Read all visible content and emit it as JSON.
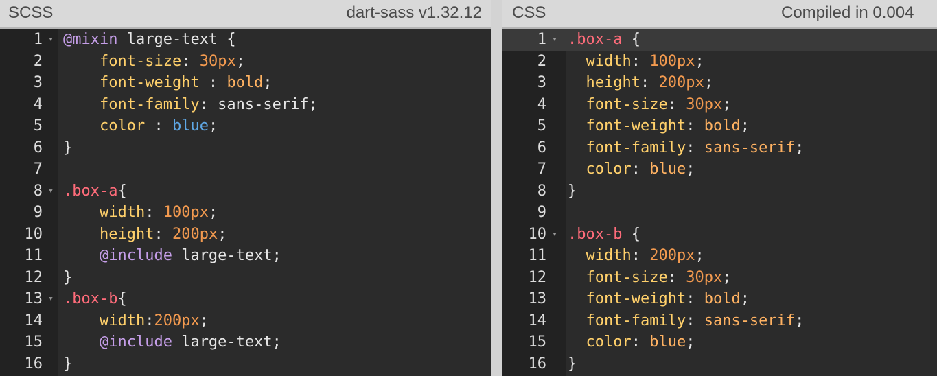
{
  "colors": {
    "background": "#2b2b2b",
    "gutter": "#222222",
    "header": "#d9d9d9",
    "property": "#ffd06b",
    "number": "#f39a4f",
    "selector": "#ff6c7a",
    "at_rule": "#c59ee8",
    "keyword": "#ffb262",
    "color_value": "#5fa8e6"
  },
  "left_pane": {
    "title": "SCSS",
    "info": "dart-sass v1.32.12",
    "lines": [
      {
        "n": "1",
        "fold": true,
        "tokens": [
          {
            "t": "@mixin",
            "c": "at"
          },
          {
            "t": " large-text {",
            "c": "plain"
          }
        ]
      },
      {
        "n": "2",
        "fold": false,
        "tokens": [
          {
            "t": "    ",
            "c": "plain"
          },
          {
            "t": "font-size",
            "c": "prop"
          },
          {
            "t": ": ",
            "c": "plain"
          },
          {
            "t": "30px",
            "c": "num"
          },
          {
            "t": ";",
            "c": "plain"
          }
        ]
      },
      {
        "n": "3",
        "fold": false,
        "tokens": [
          {
            "t": "    ",
            "c": "plain"
          },
          {
            "t": "font-weight",
            "c": "prop"
          },
          {
            "t": " : ",
            "c": "plain"
          },
          {
            "t": "bold",
            "c": "kw"
          },
          {
            "t": ";",
            "c": "plain"
          }
        ]
      },
      {
        "n": "4",
        "fold": false,
        "tokens": [
          {
            "t": "    ",
            "c": "plain"
          },
          {
            "t": "font-family",
            "c": "prop"
          },
          {
            "t": ": sans-serif;",
            "c": "plain"
          }
        ]
      },
      {
        "n": "5",
        "fold": false,
        "tokens": [
          {
            "t": "    ",
            "c": "plain"
          },
          {
            "t": "color",
            "c": "prop"
          },
          {
            "t": " : ",
            "c": "plain"
          },
          {
            "t": "blue",
            "c": "blue"
          },
          {
            "t": ";",
            "c": "plain"
          }
        ]
      },
      {
        "n": "6",
        "fold": false,
        "tokens": [
          {
            "t": "}",
            "c": "plain"
          }
        ]
      },
      {
        "n": "7",
        "fold": false,
        "tokens": []
      },
      {
        "n": "8",
        "fold": true,
        "tokens": [
          {
            "t": ".box-a",
            "c": "sel"
          },
          {
            "t": "{",
            "c": "plain"
          }
        ]
      },
      {
        "n": "9",
        "fold": false,
        "tokens": [
          {
            "t": "    ",
            "c": "plain"
          },
          {
            "t": "width",
            "c": "prop"
          },
          {
            "t": ": ",
            "c": "plain"
          },
          {
            "t": "100px",
            "c": "num"
          },
          {
            "t": ";",
            "c": "plain"
          }
        ]
      },
      {
        "n": "10",
        "fold": false,
        "tokens": [
          {
            "t": "    ",
            "c": "plain"
          },
          {
            "t": "height",
            "c": "prop"
          },
          {
            "t": ": ",
            "c": "plain"
          },
          {
            "t": "200px",
            "c": "num"
          },
          {
            "t": ";",
            "c": "plain"
          }
        ]
      },
      {
        "n": "11",
        "fold": false,
        "tokens": [
          {
            "t": "    ",
            "c": "plain"
          },
          {
            "t": "@include",
            "c": "at"
          },
          {
            "t": " large-text;",
            "c": "plain"
          }
        ]
      },
      {
        "n": "12",
        "fold": false,
        "tokens": [
          {
            "t": "}",
            "c": "plain"
          }
        ]
      },
      {
        "n": "13",
        "fold": true,
        "tokens": [
          {
            "t": ".box-b",
            "c": "sel"
          },
          {
            "t": "{",
            "c": "plain"
          }
        ]
      },
      {
        "n": "14",
        "fold": false,
        "tokens": [
          {
            "t": "    ",
            "c": "plain"
          },
          {
            "t": "width",
            "c": "prop"
          },
          {
            "t": ":",
            "c": "plain"
          },
          {
            "t": "200px",
            "c": "num"
          },
          {
            "t": ";",
            "c": "plain"
          }
        ]
      },
      {
        "n": "15",
        "fold": false,
        "tokens": [
          {
            "t": "    ",
            "c": "plain"
          },
          {
            "t": "@include",
            "c": "at"
          },
          {
            "t": " large-text;",
            "c": "plain"
          }
        ]
      },
      {
        "n": "16",
        "fold": false,
        "tokens": [
          {
            "t": "}",
            "c": "plain"
          }
        ]
      }
    ]
  },
  "right_pane": {
    "title": "CSS",
    "info": "Compiled in 0.004",
    "lines": [
      {
        "n": "1",
        "fold": true,
        "active": true,
        "tokens": [
          {
            "t": ".box-a",
            "c": "sel"
          },
          {
            "t": " {",
            "c": "plain"
          }
        ]
      },
      {
        "n": "2",
        "fold": false,
        "tokens": [
          {
            "t": "  ",
            "c": "plain"
          },
          {
            "t": "width",
            "c": "prop"
          },
          {
            "t": ": ",
            "c": "plain"
          },
          {
            "t": "100px",
            "c": "num"
          },
          {
            "t": ";",
            "c": "plain"
          }
        ]
      },
      {
        "n": "3",
        "fold": false,
        "tokens": [
          {
            "t": "  ",
            "c": "plain"
          },
          {
            "t": "height",
            "c": "prop"
          },
          {
            "t": ": ",
            "c": "plain"
          },
          {
            "t": "200px",
            "c": "num"
          },
          {
            "t": ";",
            "c": "plain"
          }
        ]
      },
      {
        "n": "4",
        "fold": false,
        "tokens": [
          {
            "t": "  ",
            "c": "plain"
          },
          {
            "t": "font-size",
            "c": "prop"
          },
          {
            "t": ": ",
            "c": "plain"
          },
          {
            "t": "30px",
            "c": "num"
          },
          {
            "t": ";",
            "c": "plain"
          }
        ]
      },
      {
        "n": "5",
        "fold": false,
        "tokens": [
          {
            "t": "  ",
            "c": "plain"
          },
          {
            "t": "font-weight",
            "c": "prop"
          },
          {
            "t": ": ",
            "c": "plain"
          },
          {
            "t": "bold",
            "c": "kw"
          },
          {
            "t": ";",
            "c": "plain"
          }
        ]
      },
      {
        "n": "6",
        "fold": false,
        "tokens": [
          {
            "t": "  ",
            "c": "plain"
          },
          {
            "t": "font-family",
            "c": "prop"
          },
          {
            "t": ": ",
            "c": "plain"
          },
          {
            "t": "sans-serif",
            "c": "kw"
          },
          {
            "t": ";",
            "c": "plain"
          }
        ]
      },
      {
        "n": "7",
        "fold": false,
        "tokens": [
          {
            "t": "  ",
            "c": "plain"
          },
          {
            "t": "color",
            "c": "prop"
          },
          {
            "t": ": ",
            "c": "plain"
          },
          {
            "t": "blue",
            "c": "kw"
          },
          {
            "t": ";",
            "c": "plain"
          }
        ]
      },
      {
        "n": "8",
        "fold": false,
        "tokens": [
          {
            "t": "}",
            "c": "plain"
          }
        ]
      },
      {
        "n": "9",
        "fold": false,
        "tokens": []
      },
      {
        "n": "10",
        "fold": true,
        "tokens": [
          {
            "t": ".box-b",
            "c": "sel"
          },
          {
            "t": " {",
            "c": "plain"
          }
        ]
      },
      {
        "n": "11",
        "fold": false,
        "tokens": [
          {
            "t": "  ",
            "c": "plain"
          },
          {
            "t": "width",
            "c": "prop"
          },
          {
            "t": ": ",
            "c": "plain"
          },
          {
            "t": "200px",
            "c": "num"
          },
          {
            "t": ";",
            "c": "plain"
          }
        ]
      },
      {
        "n": "12",
        "fold": false,
        "tokens": [
          {
            "t": "  ",
            "c": "plain"
          },
          {
            "t": "font-size",
            "c": "prop"
          },
          {
            "t": ": ",
            "c": "plain"
          },
          {
            "t": "30px",
            "c": "num"
          },
          {
            "t": ";",
            "c": "plain"
          }
        ]
      },
      {
        "n": "13",
        "fold": false,
        "tokens": [
          {
            "t": "  ",
            "c": "plain"
          },
          {
            "t": "font-weight",
            "c": "prop"
          },
          {
            "t": ": ",
            "c": "plain"
          },
          {
            "t": "bold",
            "c": "kw"
          },
          {
            "t": ";",
            "c": "plain"
          }
        ]
      },
      {
        "n": "14",
        "fold": false,
        "tokens": [
          {
            "t": "  ",
            "c": "plain"
          },
          {
            "t": "font-family",
            "c": "prop"
          },
          {
            "t": ": ",
            "c": "plain"
          },
          {
            "t": "sans-serif",
            "c": "kw"
          },
          {
            "t": ";",
            "c": "plain"
          }
        ]
      },
      {
        "n": "15",
        "fold": false,
        "tokens": [
          {
            "t": "  ",
            "c": "plain"
          },
          {
            "t": "color",
            "c": "prop"
          },
          {
            "t": ": ",
            "c": "plain"
          },
          {
            "t": "blue",
            "c": "kw"
          },
          {
            "t": ";",
            "c": "plain"
          }
        ]
      },
      {
        "n": "16",
        "fold": false,
        "tokens": [
          {
            "t": "}",
            "c": "plain"
          }
        ]
      }
    ]
  }
}
